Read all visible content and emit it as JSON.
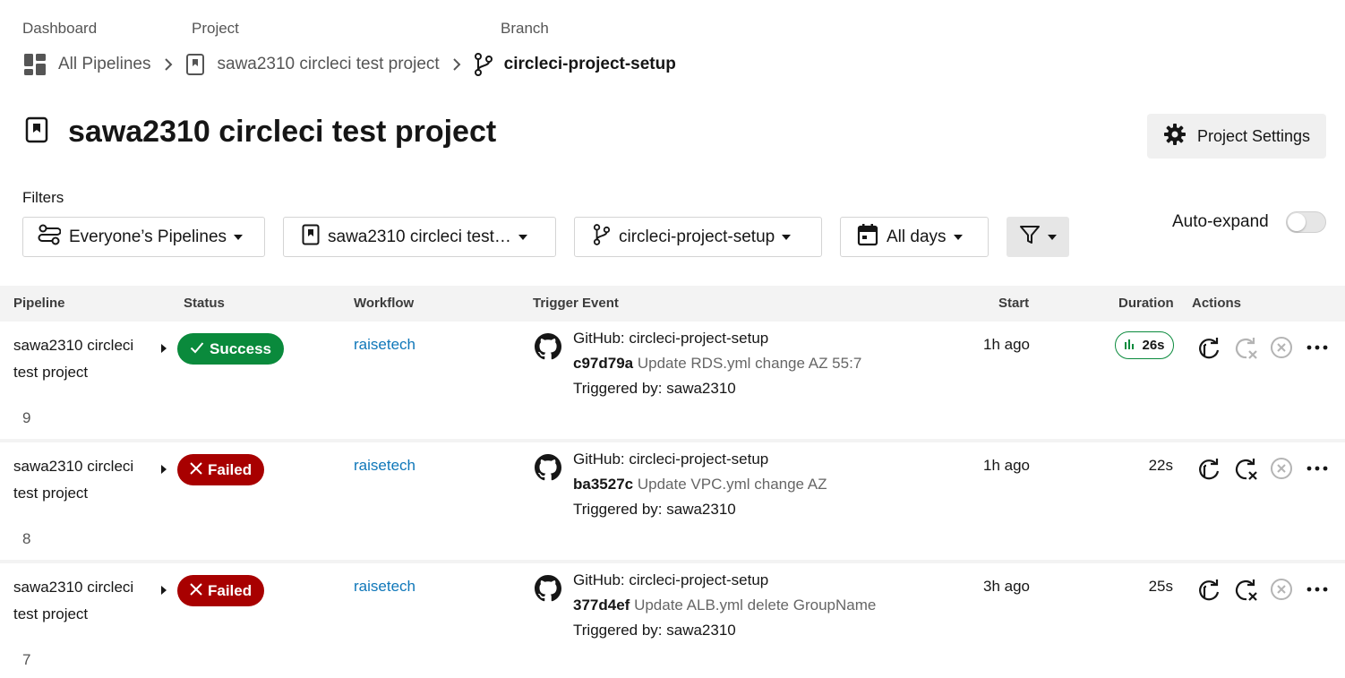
{
  "breadcrumb": {
    "dashboard_caption": "Dashboard",
    "project_caption": "Project",
    "branch_caption": "Branch",
    "all_pipelines": "All Pipelines",
    "project": "sawa2310 circleci test project",
    "branch": "circleci-project-setup"
  },
  "page": {
    "title": "sawa2310 circleci test project",
    "settings_label": "Project Settings"
  },
  "filters": {
    "label": "Filters",
    "pipelines": "Everyone’s Pipelines",
    "project": "sawa2310 circleci test…",
    "branch": "circleci-project-setup",
    "days": "All days",
    "auto_expand": "Auto-expand",
    "auto_expand_on": false
  },
  "table": {
    "headers": {
      "pipeline": "Pipeline",
      "status": "Status",
      "workflow": "Workflow",
      "trigger": "Trigger Event",
      "start": "Start",
      "duration": "Duration",
      "actions": "Actions"
    },
    "rows": [
      {
        "pipeline_name": "sawa2310 circleci test project",
        "number": "9",
        "status": "Success",
        "status_color": "#0a8a3c",
        "workflow": "raisetech",
        "trigger_title": "GitHub: circleci-project-setup",
        "commit_hash": "c97d79a",
        "commit_message": "Update RDS.yml change AZ 55:7",
        "triggered_by": "Triggered by: sawa2310",
        "start": "1h ago",
        "duration": "26s"
      },
      {
        "pipeline_name": "sawa2310 circleci test project",
        "number": "8",
        "status": "Failed",
        "status_color": "#a80000",
        "workflow": "raisetech",
        "trigger_title": "GitHub: circleci-project-setup",
        "commit_hash": "ba3527c",
        "commit_message": "Update VPC.yml change AZ",
        "triggered_by": "Triggered by: sawa2310",
        "start": "1h ago",
        "duration": "22s"
      },
      {
        "pipeline_name": "sawa2310 circleci test project",
        "number": "7",
        "status": "Failed",
        "status_color": "#a80000",
        "workflow": "raisetech",
        "trigger_title": "GitHub: circleci-project-setup",
        "commit_hash": "377d4ef",
        "commit_message": "Update ALB.yml delete GroupName",
        "triggered_by": "Triggered by: sawa2310",
        "start": "3h ago",
        "duration": "25s"
      }
    ]
  },
  "icons": {
    "dashboard": "dashboard-grid-icon",
    "project": "bookmark-project-icon",
    "branch": "git-branch-icon",
    "settings": "gear-icon",
    "filter": "funnel-icon",
    "calendar": "calendar-icon",
    "people": "people-switch-icon",
    "github": "github-icon",
    "rerun": "rerun-icon",
    "rerun_failed": "rerun-failed-icon",
    "cancel": "cancel-circle-icon",
    "more": "more-dots-icon"
  }
}
